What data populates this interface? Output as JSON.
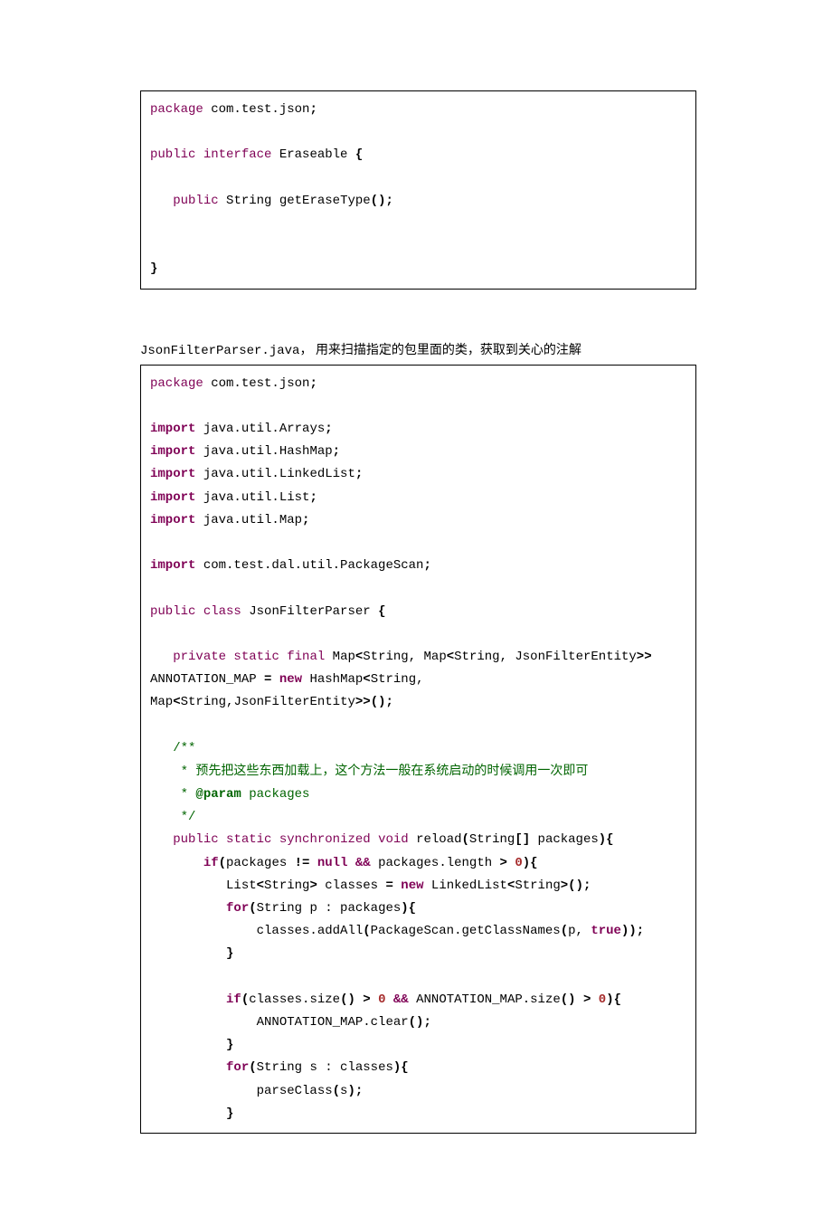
{
  "block1": {
    "l1_kw": "package",
    "l1_rest": " com.test.json",
    "semi": ";",
    "l2_a": "public",
    "l2_b": " interface",
    "l2_rest": " Eraseable ",
    "brace_open": "{",
    "l3_a": "public",
    "l3_rest": " String getEraseType",
    "l3_paren": "();",
    "brace_close": "}"
  },
  "desc": {
    "filename": "JsonFilterParser.java",
    "sep": "，  ",
    "cjk": "用来扫描指定的包里面的类，获取到关心的注解"
  },
  "block2": {
    "pkg_kw": "package",
    "pkg_rest": " com.test.json",
    "semi": ";",
    "imp": "import",
    "imp1": " java.util.Arrays",
    "imp2": " java.util.HashMap",
    "imp3": " java.util.LinkedList",
    "imp4": " java.util.List",
    "imp5": " java.util.Map",
    "imp6": " com.test.dal.util.PackageScan",
    "cls_a": "public",
    "cls_b": " class",
    "cls_name": " JsonFilterParser ",
    "brace": "{",
    "fld_a": "private",
    "fld_b": " static",
    "fld_c": " final",
    "fld_map": " Map",
    "lt": "<",
    "gt": ">",
    "gtgt": ">>",
    "str": "String",
    "comma_sp": ", ",
    "jfe": "JsonFilterEntity",
    "fld_eq_name": "ANNOTATION_MAP ",
    "eq": "=",
    "new": "new",
    "hm": " HashMap",
    "annmap_tail": "();",
    "c1": "/**",
    "c2": "    * ",
    "c2txt": "预先把这些东西加载上，这个方法一般在系统启动的时候调用一次即可",
    "c3a": "    * ",
    "c3b": "@param",
    "c3c": " packages",
    "c4": "    */",
    "m_a": "public",
    "m_b": " static",
    "m_c": " synchronized",
    "m_d": " void",
    "m_name": " reload",
    "m_sig_open": "(",
    "m_sig": "String",
    "m_sig_arr": "[]",
    "m_sig_param": " packages",
    "m_sig_close": "){",
    "if": "if",
    "if_open": "(",
    "pk": "packages ",
    "neq": "!=",
    "sp": " ",
    "null": "null",
    "amp": "&&",
    "len": " packages.length ",
    "gt_op": ">",
    "zero": "0",
    "close_brace_open": "){",
    "list": "List",
    "cls_var": " classes ",
    "ll": " LinkedList",
    "tail_paren": ">();",
    "for": "for",
    "for1_sig": "String p : packages",
    "addall": "classes.addAll",
    "addall_open": "(",
    "pkscan": "PackageScan.getClassNames",
    "pkscan_args_open": "(",
    "p": "p",
    "true": "true",
    "pkscan_close": "));",
    "rbrace": "}",
    "if2_a": "classes.size",
    "paren_empty": "()",
    "annmap": "ANNOTATION_MAP.size",
    "clear": "ANNOTATION_MAP.clear",
    "clear_tail": "();",
    "for2_sig": "String s : classes",
    "parse": "parseClass",
    "parse_open": "(",
    "s": "s",
    "parse_close": ");"
  }
}
